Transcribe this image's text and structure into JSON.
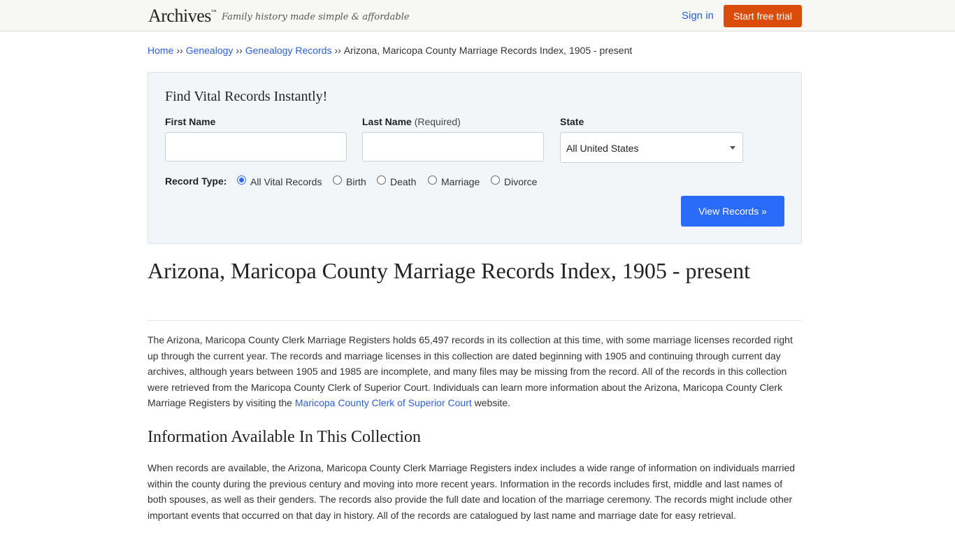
{
  "header": {
    "logo": "Archives",
    "tagline": "Family history made simple & affordable",
    "signin": "Sign in",
    "trial": "Start free trial"
  },
  "breadcrumb": {
    "items": [
      "Home",
      "Genealogy",
      "Genealogy Records"
    ],
    "current": "Arizona, Maricopa County Marriage Records Index, 1905 - present",
    "separator": "››"
  },
  "search": {
    "title": "Find Vital Records Instantly!",
    "first_name_label": "First Name",
    "last_name_label": "Last Name",
    "last_name_required": "(Required)",
    "state_label": "State",
    "state_value": "All United States",
    "record_type_label": "Record Type:",
    "record_types": [
      "All Vital Records",
      "Birth",
      "Death",
      "Marriage",
      "Divorce"
    ],
    "selected_record_type": "All Vital Records",
    "submit": "View Records »"
  },
  "content": {
    "title": "Arizona, Maricopa County Marriage Records Index, 1905 - present",
    "intro_text": "The Arizona, Maricopa County Clerk Marriage Registers holds 65,497 records in its collection at this time, with some marriage licenses recorded right up through the current year. The records and marriage licenses in this collection are dated beginning with 1905 and continuing through current day archives, although years between 1905 and 1985 are incomplete, and many files may be missing from the record. All of the records in this collection were retrieved from the Maricopa County Clerk of Superior Court. Individuals can learn more information about the Arizona, Maricopa County Clerk Marriage Registers by visiting the",
    "intro_link": "Maricopa County Clerk of Superior Court",
    "intro_tail": "website.",
    "section_heading": "Information Available In This Collection",
    "section_text": "When records are available, the Arizona, Maricopa County Clerk Marriage Registers index includes a wide range of information on individuals married within the county during the previous century and moving into more recent years. Information in the records includes first, middle and last names of both spouses, as well as their genders. The records also provide the full date and location of the marriage ceremony. The records might include other important events that occurred on that day in history. All of the records are catalogued by last name and marriage date for easy retrieval."
  },
  "colors": {
    "link": "#2b5fd9",
    "trial_button": "#d94c0a",
    "view_button": "#2b6bfa",
    "panel_bg": "#f3f6f9"
  }
}
